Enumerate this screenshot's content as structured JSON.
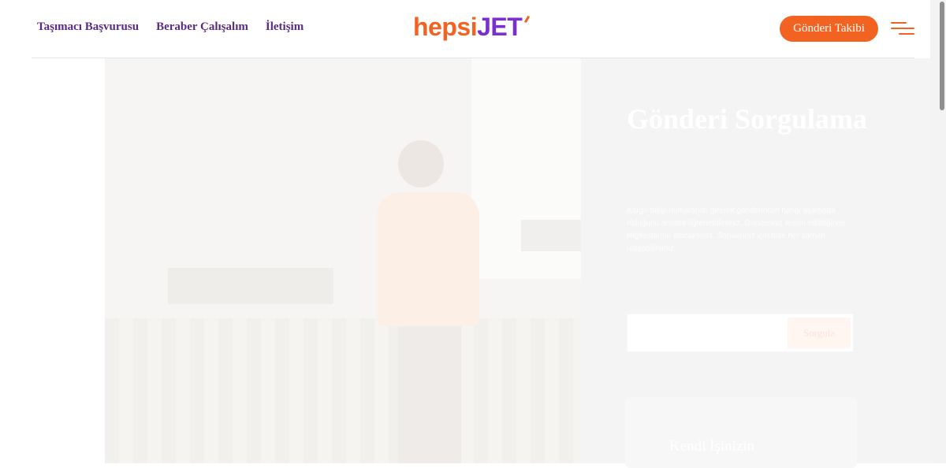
{
  "header": {
    "nav": [
      "Taşımacı Başvurusu",
      "Beraber Çalışalım",
      "İletişim"
    ],
    "logo_part1": "hepsi",
    "logo_part2": "JET",
    "track_button": "Gönderi Takibi"
  },
  "hero": {
    "title": "Gönderi Sorgulama",
    "description": "Kargo takip numaranızı girerek gönderinizin hangi aşamada olduğunu anında öğrenebilirsiniz. Gönderiniz teslim edildiğinde bilgilendirme alacaksınız. Sorularınız için bize her zaman ulaşabilirsiniz.",
    "query_button": "Sorgula",
    "input_placeholder": ""
  },
  "card": {
    "title": "Kendi İşinizin"
  },
  "colors": {
    "brand_orange": "#f26322",
    "brand_purple": "#7a2fd0",
    "nav_purple": "#5b2a86"
  }
}
